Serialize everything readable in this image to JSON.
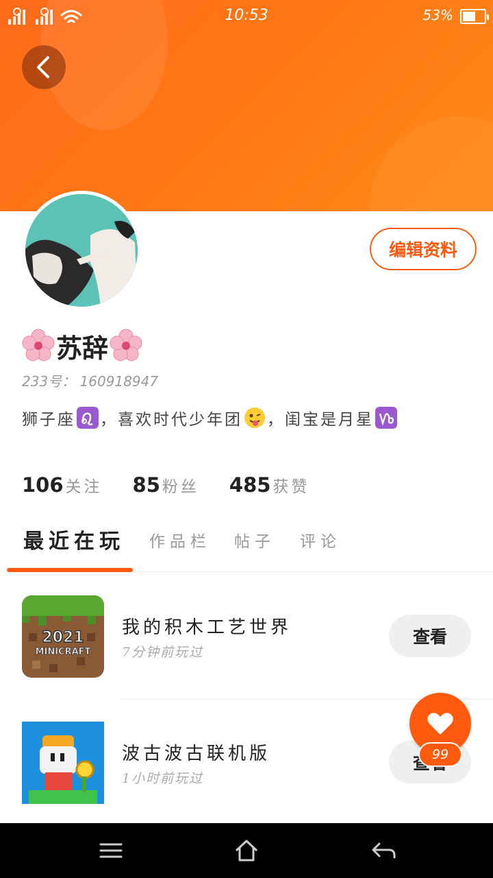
{
  "status_bar": {
    "time": "10:53",
    "battery_percent": "53%",
    "battery_level": 0.53
  },
  "profile": {
    "name": "苏辞",
    "name_decoration_icon": "cherry-blossom-icon",
    "id_text": "233号： 160918947",
    "bio": {
      "part1": "狮子座",
      "emoji1": "leo-icon",
      "part2": "，喜欢时代少年团",
      "emoji2": "winking-tongue-face-icon",
      "part3": "，闺宝是月星",
      "emoji3": "capricorn-icon"
    },
    "edit_label": "编辑资料"
  },
  "stats": [
    {
      "value": "106",
      "label": "关注"
    },
    {
      "value": "85",
      "label": "粉丝"
    },
    {
      "value": "485",
      "label": "获赞"
    }
  ],
  "tabs": [
    {
      "label": "最近在玩",
      "active": true
    },
    {
      "label": "作品栏",
      "active": false
    },
    {
      "label": "帖子",
      "active": false
    },
    {
      "label": "评论",
      "active": false
    }
  ],
  "games": [
    {
      "title": "我的积木工艺世界",
      "time": "7分钟前玩过",
      "button": "查看",
      "icon_text": "2021",
      "icon_subtext": "MINICRAFT"
    },
    {
      "title": "波古波古联机版",
      "time": "1小时前玩过",
      "button": "查看"
    }
  ],
  "like_fab": {
    "count": "99"
  },
  "colors": {
    "accent": "#ff5a0e",
    "header": "#ff7a14"
  }
}
